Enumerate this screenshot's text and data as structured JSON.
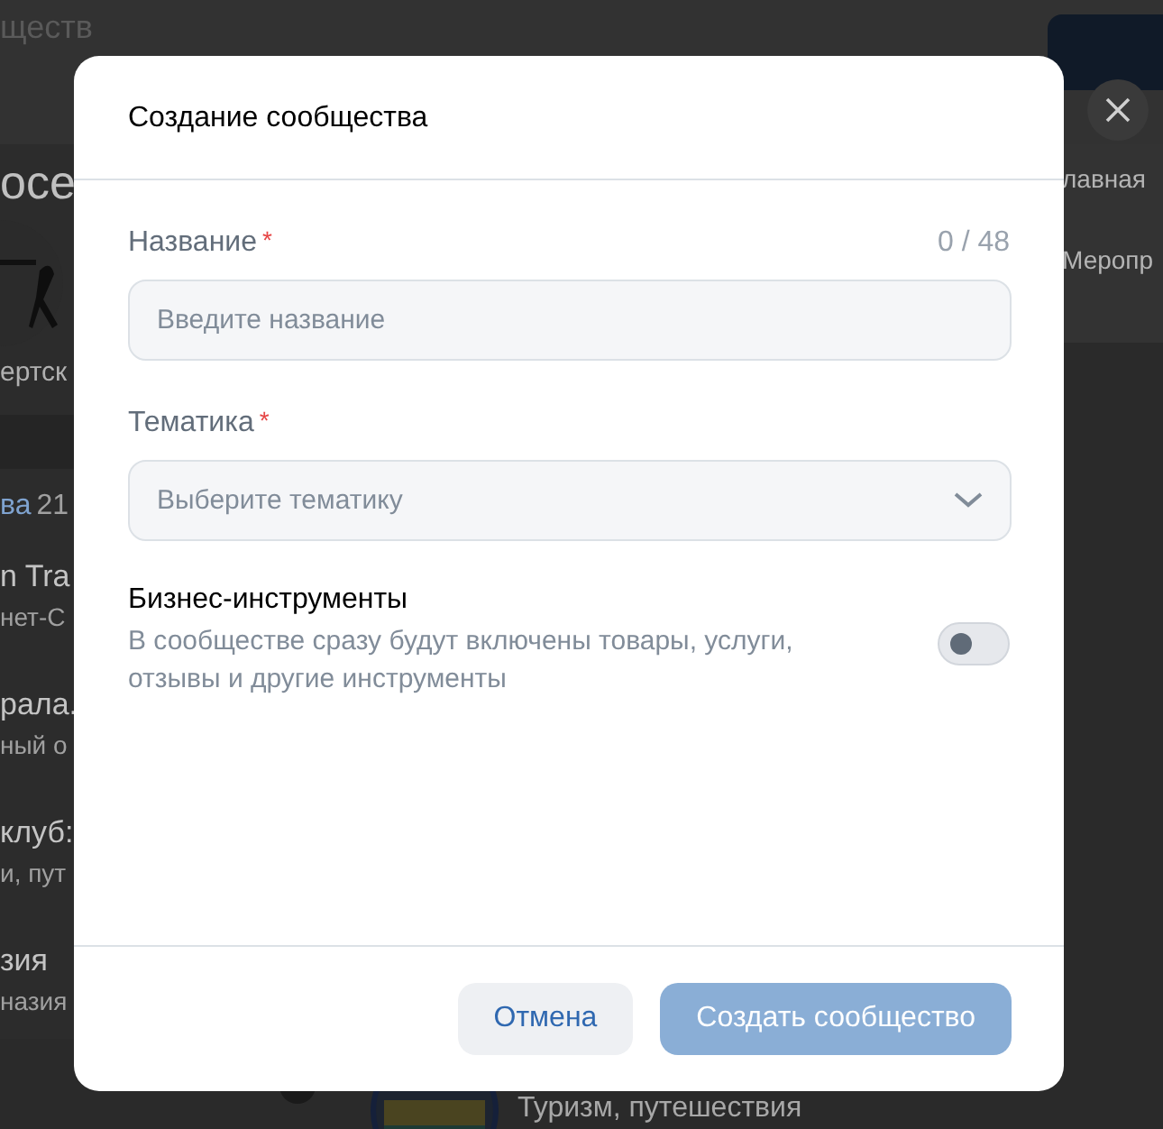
{
  "background": {
    "search_field": "ществ",
    "section_title": "осе",
    "avatar_caption": "ертск",
    "list_header": {
      "title": "ва",
      "count": "21"
    },
    "list_items": [
      {
        "title": "n Tra",
        "subtitle": "нет-С"
      },
      {
        "title": "рала.",
        "subtitle": "ный о"
      },
      {
        "title": "клуб:",
        "subtitle": "и, пут"
      },
      {
        "title": "зия",
        "subtitle": "назия"
      }
    ],
    "bottom_item": {
      "subtitle": "Туризм, путешествия"
    },
    "menu_items": [
      "лавная",
      "Меропр"
    ]
  },
  "modal": {
    "title": "Создание сообщества",
    "fields": [
      {
        "kind": "input",
        "label": "Название",
        "required_mark": "*",
        "counter": "0 / 48",
        "placeholder": "Введите название"
      },
      {
        "kind": "select",
        "label": "Тематика",
        "required_mark": "*",
        "placeholder": "Выберите тематику"
      }
    ],
    "option": {
      "title": "Бизнес-инструменты",
      "description": "В сообществе сразу будут включены товары, услуги, отзывы и другие инструменты",
      "on": false
    },
    "buttons": [
      {
        "kind": "secondary",
        "label": "Отмена",
        "disabled": false
      },
      {
        "kind": "primary",
        "label": "Создать сообщество",
        "disabled": true
      }
    ]
  }
}
